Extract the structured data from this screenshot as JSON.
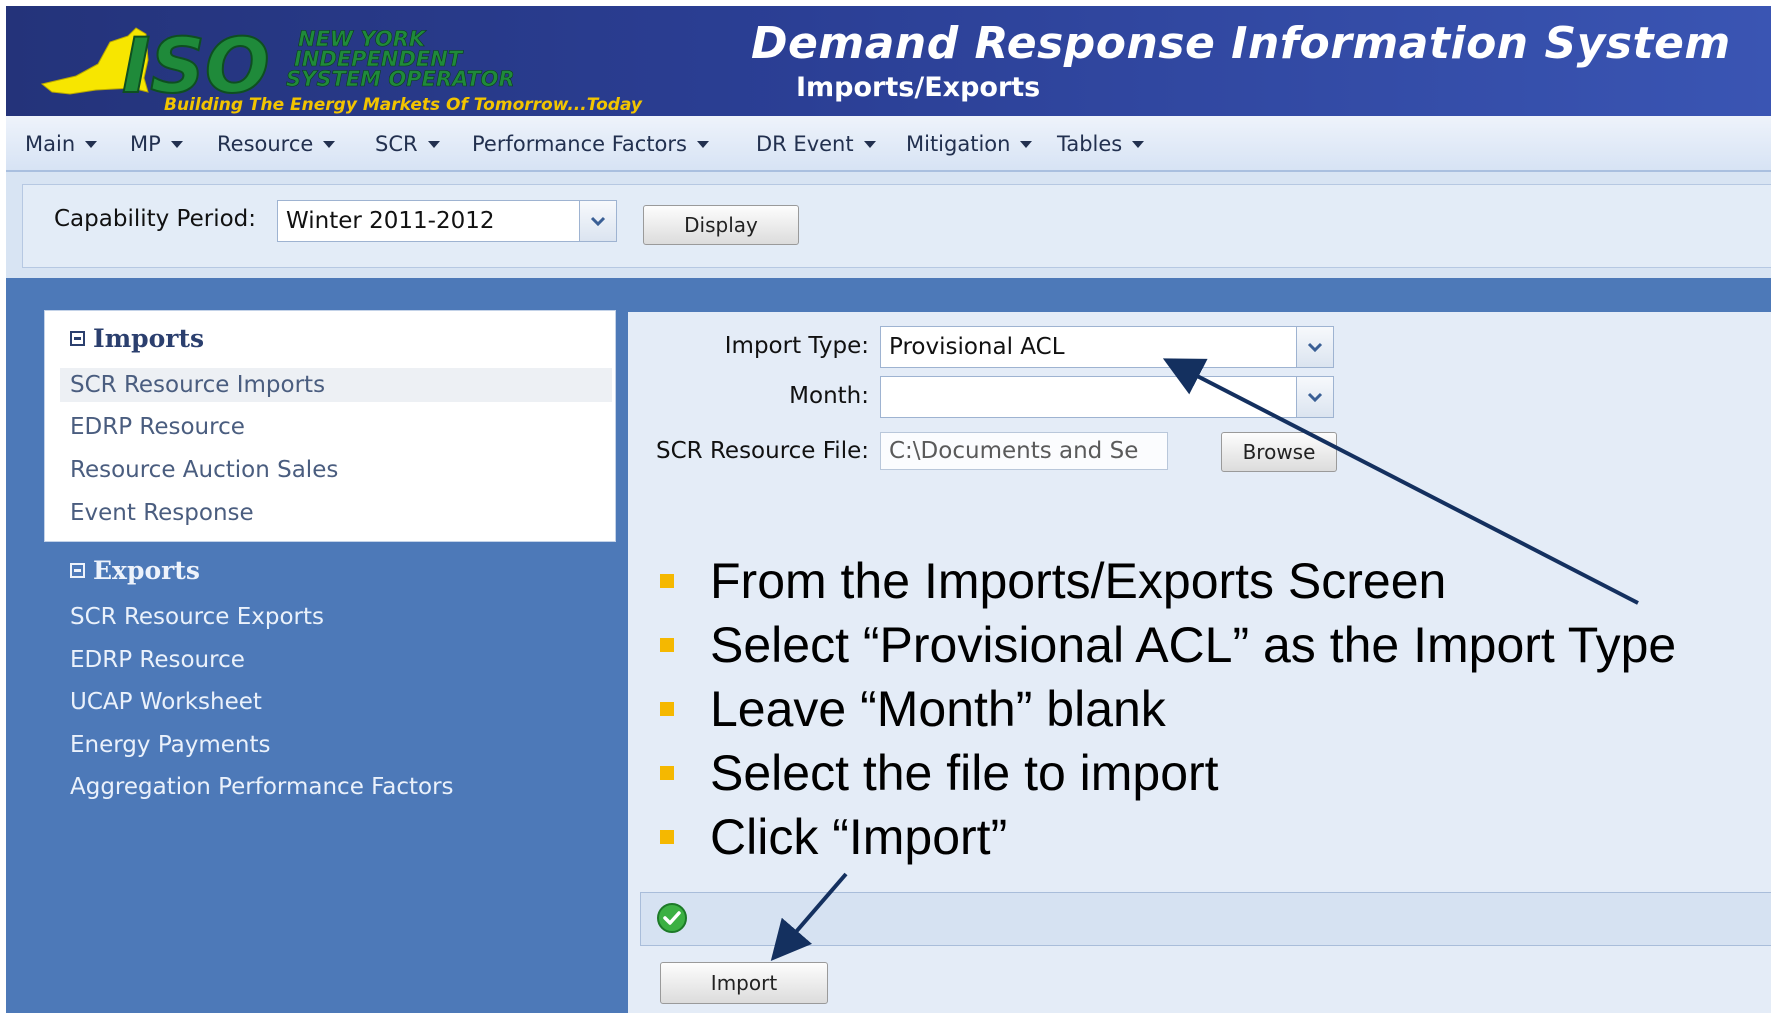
{
  "header": {
    "logo": {
      "wordmark": "ISO",
      "org_lines": [
        "NEW YORK",
        "INDEPENDENT",
        "SYSTEM OPERATOR"
      ],
      "tagline": "Building The Energy Markets Of Tomorrow...Today"
    },
    "title": "Demand Response Information System",
    "subtitle": "Imports/Exports"
  },
  "menu": {
    "items": [
      {
        "label": "Main"
      },
      {
        "label": "MP"
      },
      {
        "label": "Resource"
      },
      {
        "label": "SCR"
      },
      {
        "label": "Performance Factors"
      },
      {
        "label": "DR Event"
      },
      {
        "label": "Mitigation"
      },
      {
        "label": "Tables"
      }
    ]
  },
  "capability": {
    "label": "Capability Period:",
    "selected": "Winter 2011-2012",
    "display_button": "Display"
  },
  "sidebar": {
    "imports": {
      "heading": "Imports",
      "items": [
        {
          "label": "SCR Resource Imports"
        },
        {
          "label": "EDRP Resource"
        },
        {
          "label": "Resource Auction Sales"
        },
        {
          "label": "Event Response"
        }
      ]
    },
    "exports": {
      "heading": "Exports",
      "items": [
        {
          "label": "SCR Resource Exports"
        },
        {
          "label": "EDRP Resource"
        },
        {
          "label": "UCAP Worksheet"
        },
        {
          "label": "Energy Payments"
        },
        {
          "label": "Aggregation Performance Factors"
        }
      ]
    }
  },
  "form": {
    "import_type_label": "Import Type:",
    "import_type_value": "Provisional ACL",
    "month_label": "Month:",
    "month_value": "",
    "file_label": "SCR Resource File:",
    "file_value": "C:\\Documents and Se",
    "browse_button": "Browse",
    "import_button": "Import"
  },
  "instructions": [
    "From the Imports/Exports Screen",
    "Select “Provisional ACL” as the Import Type",
    "Leave “Month” blank",
    "Select the file to import",
    "Click “Import”"
  ],
  "colors": {
    "header_blue": "#2b3f95",
    "body_blue": "#4d79b8",
    "panel_light": "#e4ecf7",
    "bullet_yellow": "#f5b800",
    "arrow_navy": "#14305f",
    "logo_yellow": "#f7e600"
  }
}
